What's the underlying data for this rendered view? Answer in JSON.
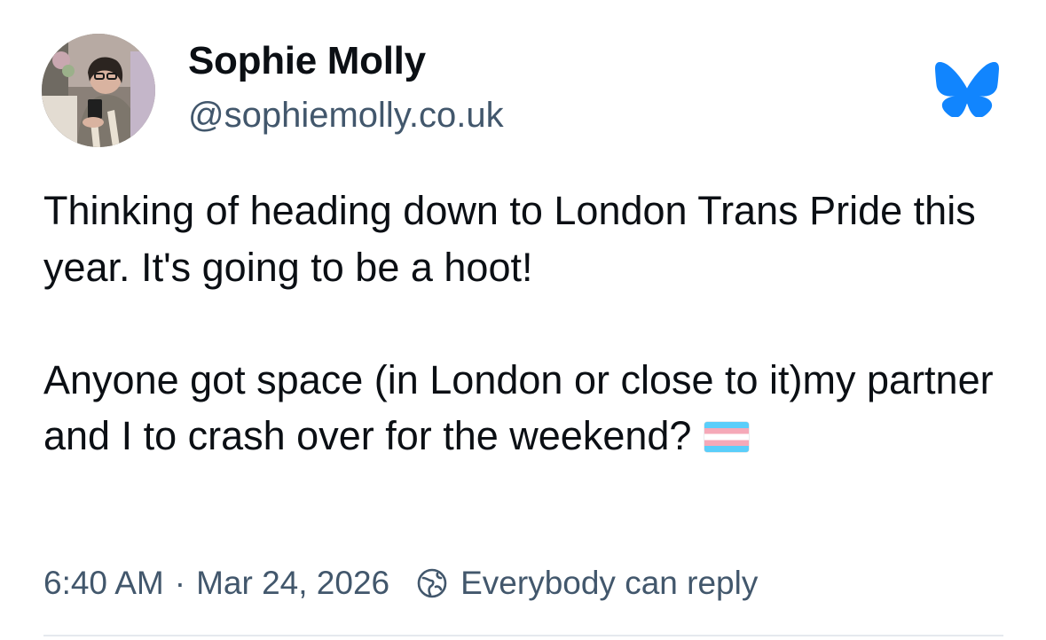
{
  "author": {
    "display_name": "Sophie Molly",
    "handle": "@sophiemolly.co.uk",
    "avatar_icon": "profile-photo"
  },
  "app": {
    "logo_icon": "bluesky-butterfly-icon",
    "logo_color": "#1185fe"
  },
  "post": {
    "paragraph_1": "Thinking of heading down to London Trans Pride this year. It's going to be a hoot!",
    "paragraph_2": "Anyone got space (in London or close to it)my partner and I to crash over for the weekend?",
    "emoji_icon": "transgender-flag-icon",
    "flag_colors": [
      "#5bcefa",
      "#f5a9b8",
      "#ffffff"
    ]
  },
  "meta": {
    "time": "6:40 AM",
    "separator": "·",
    "date": "Mar 24, 2026",
    "reply_setting": "Everybody can reply",
    "reply_icon": "globe-icon"
  }
}
